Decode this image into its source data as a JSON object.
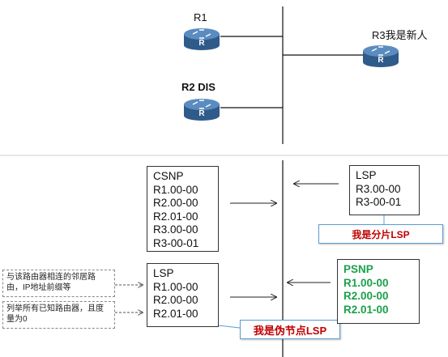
{
  "routers": {
    "r1": {
      "label": "R1"
    },
    "r2": {
      "label": "R2 DIS"
    },
    "r3": {
      "label": "R3我是新人"
    }
  },
  "csnp": {
    "title": "CSNP",
    "entries": [
      "R1.00-00",
      "R2.00-00",
      "R2.01-00",
      "R3.00-00",
      "R3-00-01"
    ]
  },
  "lsp_r3": {
    "title": "LSP",
    "entries": [
      "R3.00-00",
      "R3-00-01"
    ],
    "callout": "我是分片LSP"
  },
  "lsp_r2": {
    "title": "LSP",
    "entries": [
      "R1.00-00",
      "R2.00-00",
      "R2.01-00"
    ],
    "callout": "我是伪节点LSP"
  },
  "psnp": {
    "title": "PSNP",
    "entries": [
      "R1.00-00",
      "R2.00-00",
      "R2.01-00"
    ],
    "color": "#1aa14a"
  },
  "notes": {
    "neighbors": "与该路由器相连的邻居路由，IP地址前缀等",
    "all_routers": "列举所有已知路由器，且度量为0"
  },
  "colors": {
    "callout_text": "#c00000",
    "callout_border": "#5b9bd5",
    "router_body": "#3d6b9c"
  }
}
